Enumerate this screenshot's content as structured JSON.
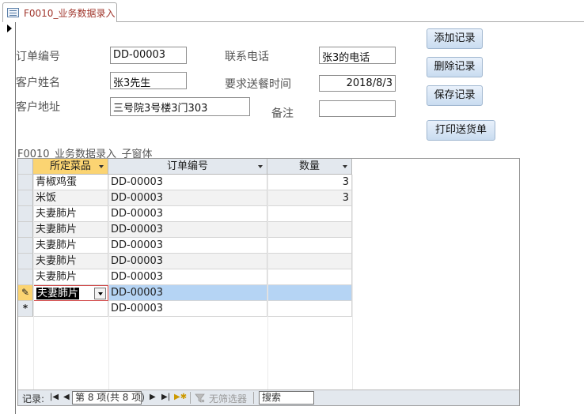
{
  "tab": {
    "title": "F0010_业务数据录入"
  },
  "form": {
    "labels": {
      "order_no": "订单编号",
      "customer_name": "客户姓名",
      "customer_address": "客户地址",
      "phone": "联系电话",
      "delivery_time": "要求送餐时间",
      "notes": "备注"
    },
    "values": {
      "order_no": "DD-00003",
      "customer_name": "张3先生",
      "customer_address": "三号院3号楼3门303",
      "phone": "张3的电话",
      "delivery_time": "2018/8/3",
      "notes": ""
    },
    "buttons": {
      "add": "添加记录",
      "delete": "删除记录",
      "save": "保存记录",
      "print": "打印送货单"
    }
  },
  "subform": {
    "label": "F0010_业务数据录入_子窗体",
    "columns": [
      "所定菜品",
      "订单编号",
      "数量"
    ],
    "rows": [
      [
        "青椒鸡蛋",
        "DD-00003",
        "3"
      ],
      [
        "米饭",
        "DD-00003",
        "3"
      ],
      [
        "夫妻肺片",
        "DD-00003",
        ""
      ],
      [
        "夫妻肺片",
        "DD-00003",
        ""
      ],
      [
        "夫妻肺片",
        "DD-00003",
        ""
      ],
      [
        "夫妻肺片",
        "DD-00003",
        ""
      ],
      [
        "夫妻肺片",
        "DD-00003",
        ""
      ],
      [
        "夫妻肺片",
        "DD-00003",
        ""
      ]
    ],
    "new_row": [
      "",
      "DD-00003",
      ""
    ],
    "current_row_index": 7,
    "new_row_marker": "*",
    "edit_marker": "✎"
  },
  "navigation": {
    "records_label": "记录:",
    "position": "第 8 项(共 8 项)",
    "filter_label": "无筛选器",
    "search_placeholder": "搜索"
  },
  "colors": {
    "tab_text": "#a0352b",
    "header_bg": "#e3e8ee",
    "selected_header": "#fbd472",
    "current_row": "#b5d4f4",
    "button_top": "#e9f1fb",
    "button_bottom": "#c9dcf0"
  }
}
